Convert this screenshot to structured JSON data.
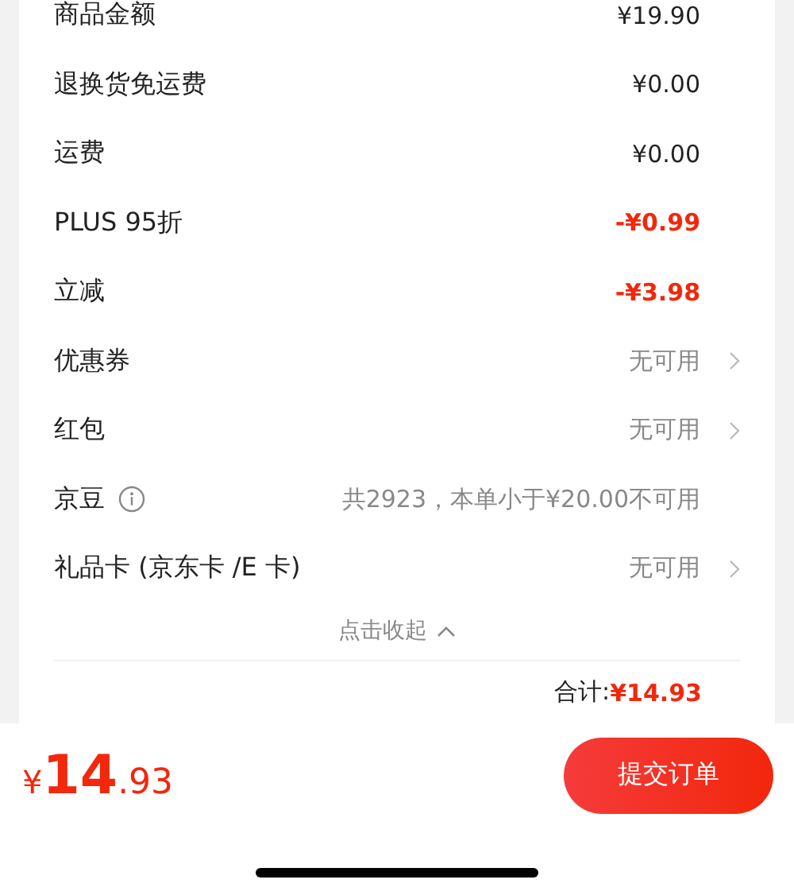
{
  "rows": [
    {
      "kind": "plain",
      "label": "商品金额",
      "value": "¥19.90"
    },
    {
      "kind": "plain",
      "label": "退换货免运费",
      "value": "¥0.00"
    },
    {
      "kind": "plain",
      "label": "运费",
      "value": "¥0.00"
    },
    {
      "kind": "discount",
      "label": "PLUS 95折",
      "value": "-¥0.99"
    },
    {
      "kind": "discount",
      "label": "立减",
      "value": "-¥3.98"
    },
    {
      "kind": "link",
      "label": "优惠券",
      "value": "无可用"
    },
    {
      "kind": "link",
      "label": "红包",
      "value": "无可用"
    },
    {
      "kind": "info",
      "label": "京豆",
      "value": "共2923，本单小于¥20.00不可用"
    },
    {
      "kind": "link",
      "label": "礼品卡 (京东卡 /E 卡)",
      "value": "无可用"
    }
  ],
  "collapse": {
    "label": "点击收起"
  },
  "total": {
    "label": "合计:",
    "value": "¥14.93"
  },
  "bottom_bar": {
    "currency": "¥",
    "integer": "14",
    "decimal": ".93",
    "submit": "提交订单"
  }
}
